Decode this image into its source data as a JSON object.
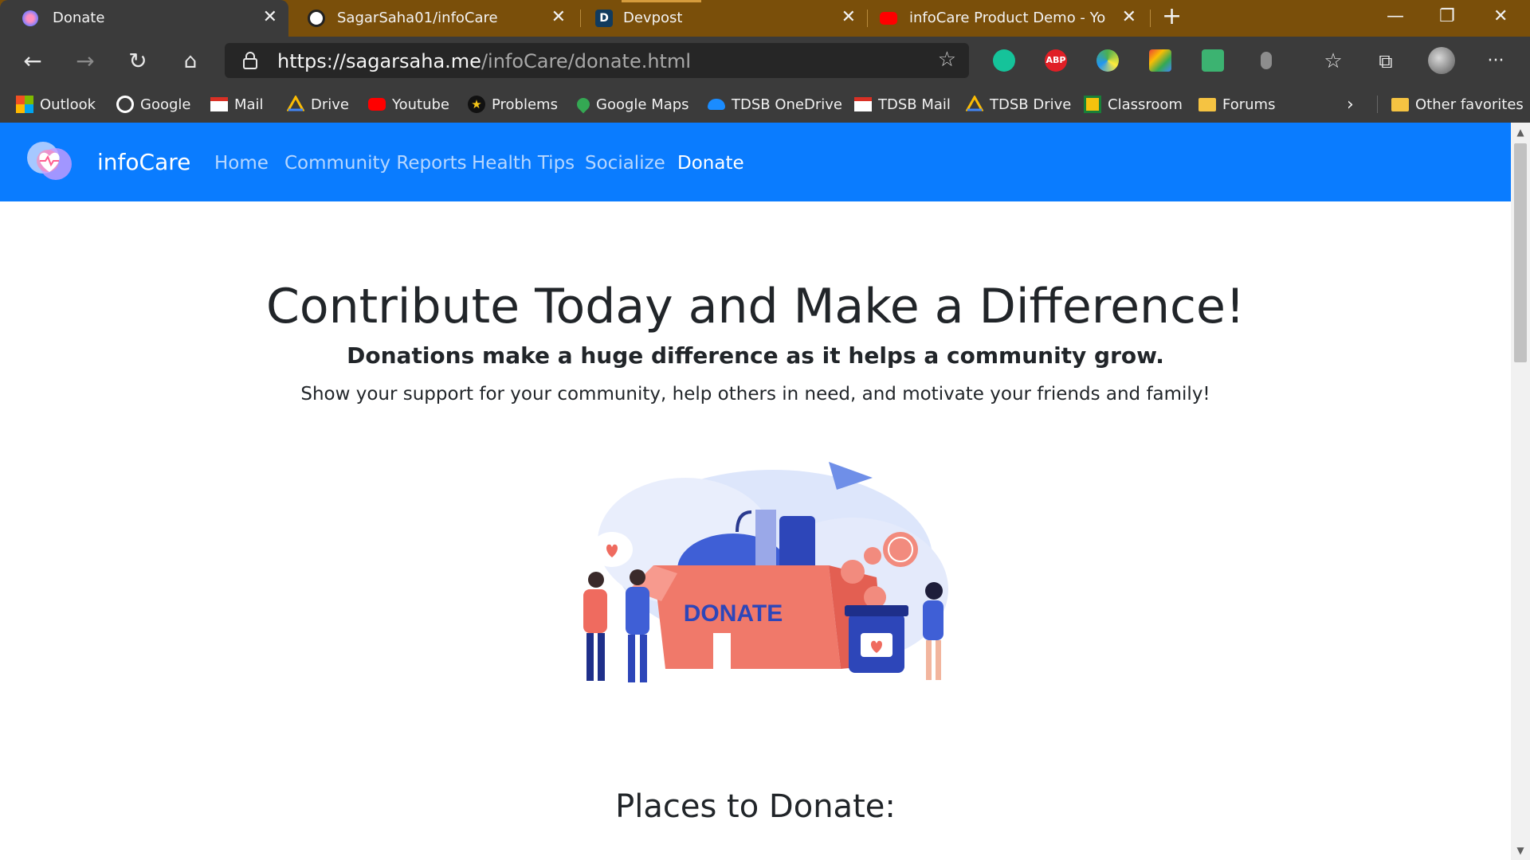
{
  "browser": {
    "tabs": [
      {
        "title": "Donate",
        "favicon": "infocare-heart-icon"
      },
      {
        "title": "SagarSaha01/infoCare",
        "favicon": "github-icon"
      },
      {
        "title": "Devpost",
        "favicon": "devpost-icon"
      },
      {
        "title": "infoCare Product Demo - YouTube",
        "favicon": "youtube-icon"
      }
    ],
    "new_tab": "+",
    "close": "✕",
    "url": {
      "host": "https://sagarsaha.me",
      "path": "/infoCare/donate.html"
    }
  },
  "bookmarks": [
    {
      "label": "Outlook",
      "icon": "microsoft-icon"
    },
    {
      "label": "Google",
      "icon": "google-icon"
    },
    {
      "label": "Mail",
      "icon": "gmail-icon"
    },
    {
      "label": "Drive",
      "icon": "drive-icon"
    },
    {
      "label": "Youtube",
      "icon": "youtube-icon"
    },
    {
      "label": "Problems",
      "icon": "star-badge-icon"
    },
    {
      "label": "Google Maps",
      "icon": "maps-pin-icon"
    },
    {
      "label": "TDSB OneDrive",
      "icon": "onedrive-cloud-icon"
    },
    {
      "label": "TDSB Mail",
      "icon": "gmail-icon"
    },
    {
      "label": "TDSB Drive",
      "icon": "drive-icon"
    },
    {
      "label": "Classroom",
      "icon": "classroom-icon"
    },
    {
      "label": "Forums",
      "icon": "folder-icon"
    },
    {
      "label": "Other favorites",
      "icon": "folder-icon"
    }
  ],
  "ext_labels": {
    "abp": "ABP"
  },
  "site": {
    "brand": "infoCare",
    "nav": [
      "Home",
      "Community Reports",
      "Health Tips",
      "Socialize",
      "Donate"
    ],
    "active_nav": "Donate"
  },
  "hero": {
    "title": "Contribute Today and Make a Difference!",
    "subtitle": "Donations make a huge difference as it helps a community grow.",
    "lead": "Show your support for your community, help others in need, and motivate your friends and family!"
  },
  "illustration": {
    "box_label": "DONATE"
  },
  "section": {
    "title": "Places to Donate:"
  },
  "colors": {
    "brand_blue": "#0a7cff",
    "tab_bar": "#7a4f0a",
    "chrome": "#3b3b3b"
  }
}
